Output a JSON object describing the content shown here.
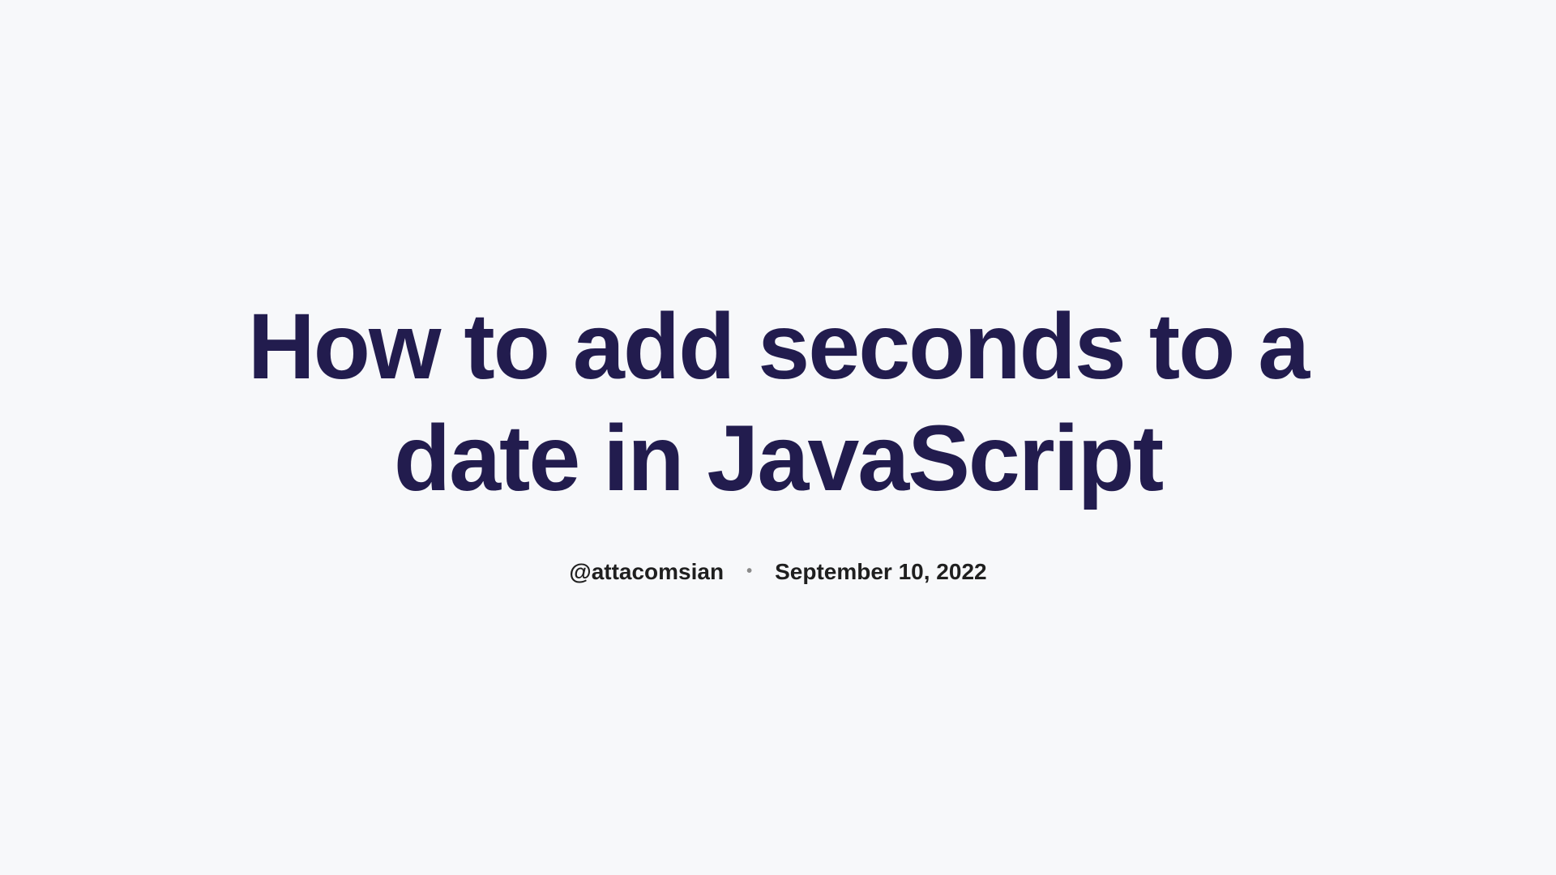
{
  "article": {
    "title": "How to add seconds to a date in JavaScript",
    "author": "@attacomsian",
    "separator": "•",
    "date": "September 10, 2022"
  }
}
